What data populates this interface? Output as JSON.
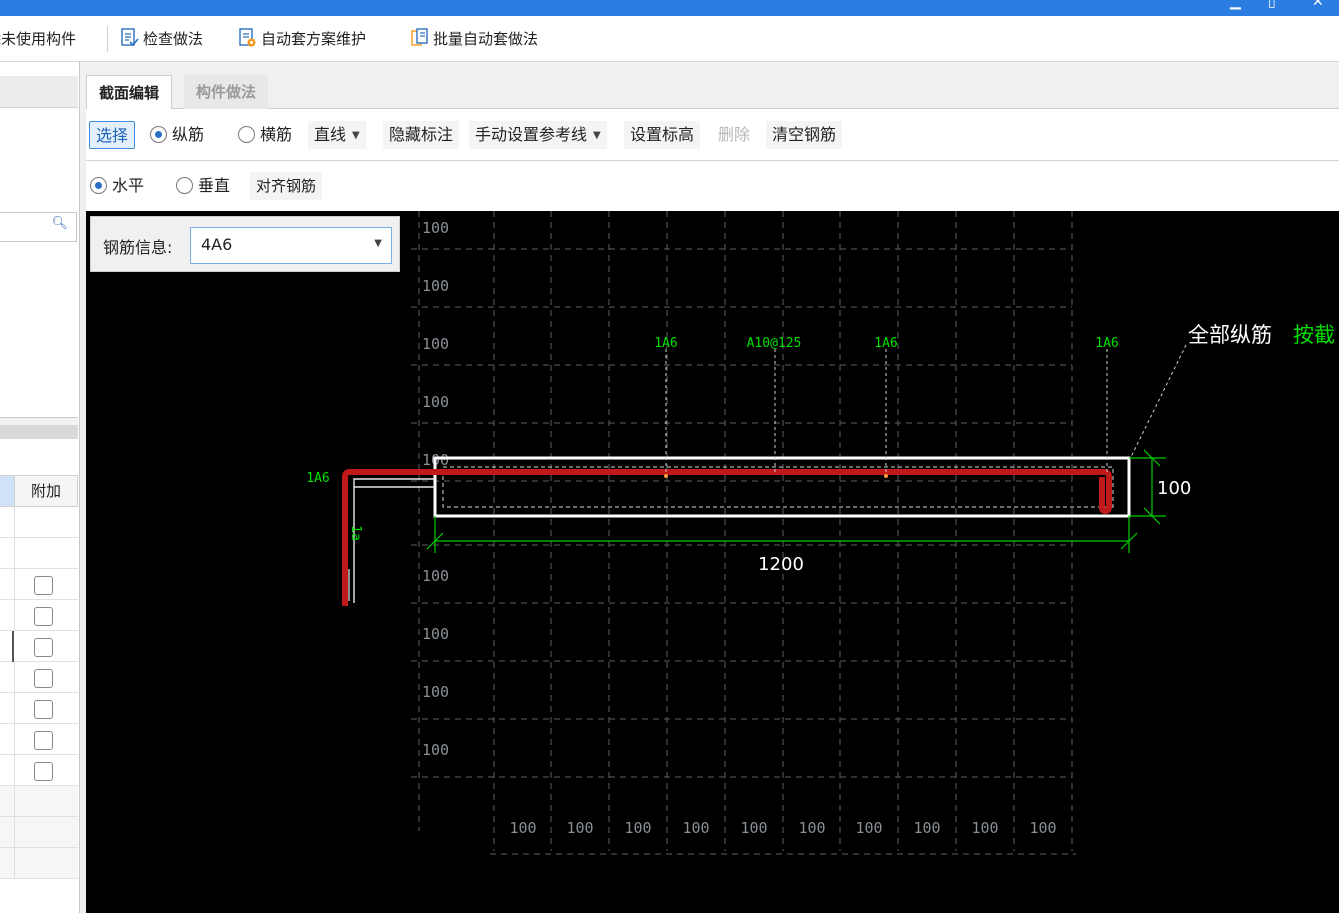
{
  "toolbar": {
    "items": [
      {
        "label": "除未使用构件"
      },
      {
        "label": "检查做法"
      },
      {
        "label": "自动套方案维护"
      },
      {
        "label": "批量自动套做法"
      }
    ]
  },
  "left_panel": {
    "grid_header": "附加"
  },
  "tabs": [
    {
      "label": "截面编辑",
      "active": true
    },
    {
      "label": "构件做法",
      "active": false
    }
  ],
  "edit_toolbar": {
    "select": "选择",
    "radio_long": "纵筋",
    "radio_stirrup": "横筋",
    "line_mode": "直线",
    "hide_label": "隐藏标注",
    "manual_ref_line": "手动设置参考线",
    "set_elevation": "设置标高",
    "delete": "删除",
    "clear_rebar": "清空钢筋"
  },
  "align_toolbar": {
    "horizontal": "水平",
    "vertical": "垂直",
    "align_rebar": "对齐钢筋"
  },
  "rebar_info": {
    "label": "钢筋信息:",
    "value": "4A6"
  },
  "canvas": {
    "row_labels": [
      "100",
      "100",
      "100",
      "100",
      "100",
      "100",
      "100",
      "100",
      "100",
      "100"
    ],
    "col_labels": [
      "100",
      "100",
      "100",
      "100",
      "100",
      "100",
      "100",
      "100",
      "100",
      "100"
    ],
    "rebar_labels": [
      "1A6",
      "A10@125",
      "1A6",
      "1A6",
      "1A6"
    ],
    "hook_label": "1a",
    "dim_width": "1200",
    "dim_height": "100",
    "note_white": "全部纵筋",
    "note_green": "按截"
  },
  "colors": {
    "accent": "#2b7de1",
    "rebar": "#c0191a",
    "annotation": "#00e000"
  }
}
